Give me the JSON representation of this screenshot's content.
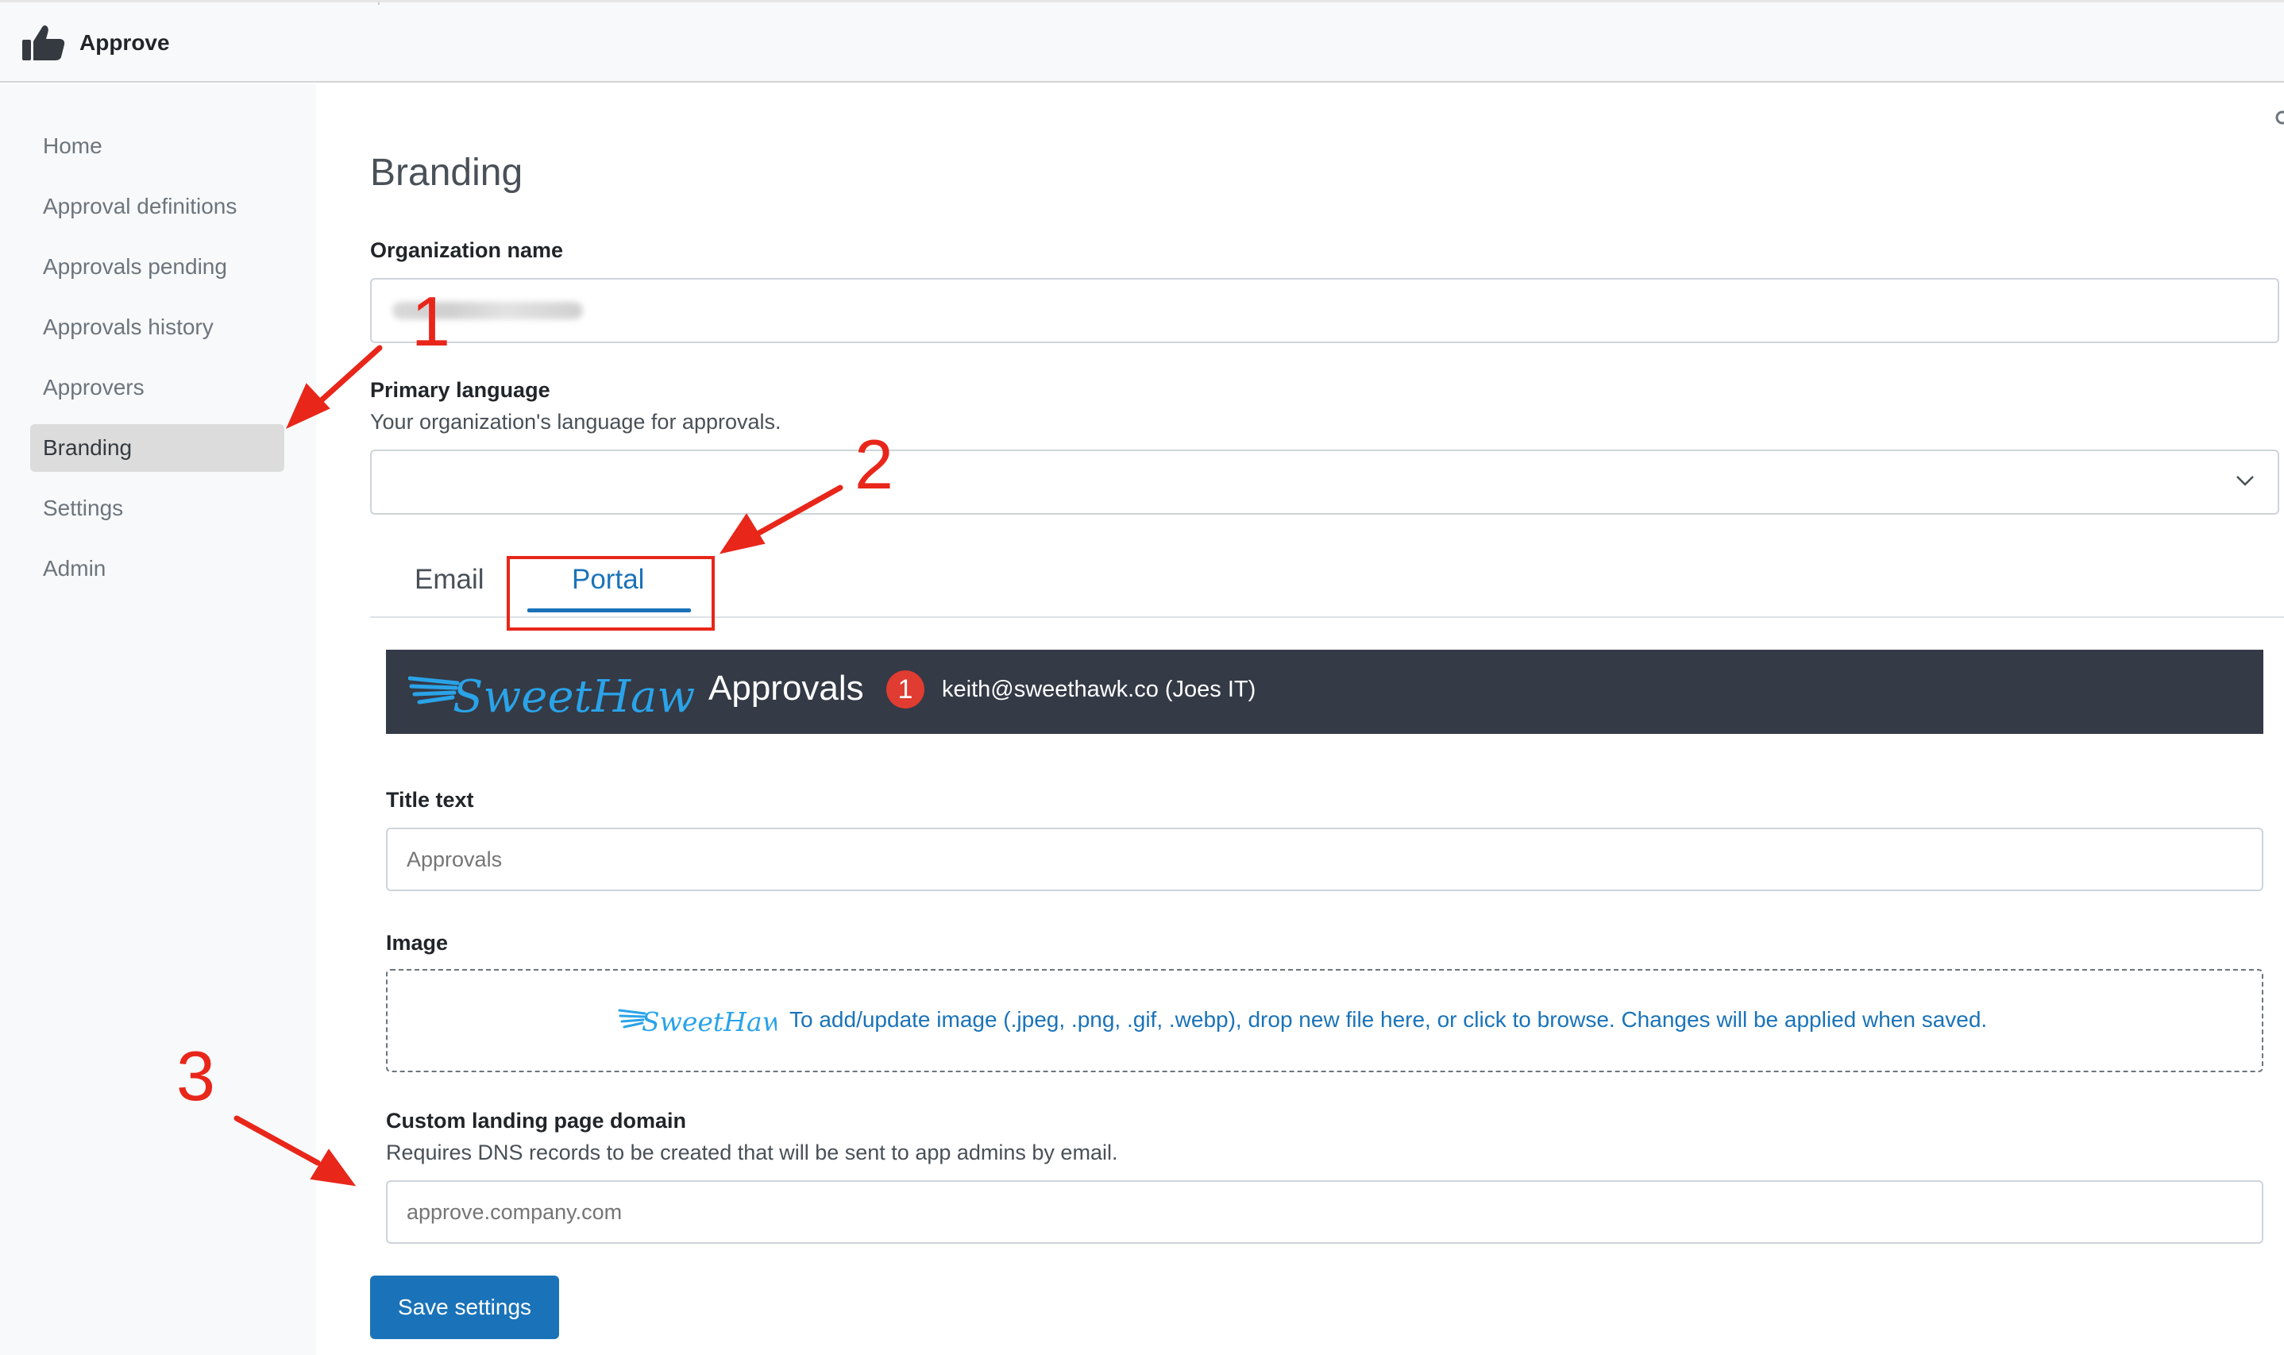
{
  "app": {
    "title": "Approve"
  },
  "sidebar": {
    "items": [
      {
        "label": "Home"
      },
      {
        "label": "Approval definitions"
      },
      {
        "label": "Approvals pending"
      },
      {
        "label": "Approvals history"
      },
      {
        "label": "Approvers"
      },
      {
        "label": "Branding",
        "active": true
      },
      {
        "label": "Settings"
      },
      {
        "label": "Admin"
      }
    ]
  },
  "page": {
    "title": "Branding"
  },
  "form": {
    "org_name": {
      "label": "Organization name"
    },
    "primary_language": {
      "label": "Primary language",
      "help": "Your organization's language for approvals.",
      "value": ""
    },
    "tabs": [
      {
        "label": "Email",
        "active": false
      },
      {
        "label": "Portal",
        "active": true
      }
    ],
    "preview": {
      "brand": "SweetHawk",
      "title": "Approvals",
      "badge_count": "1",
      "user": "keith@sweethawk.co (Joes IT)"
    },
    "title_text": {
      "label": "Title text",
      "placeholder": "Approvals"
    },
    "image": {
      "label": "Image",
      "logo": "SweetHawk",
      "drop_text": "To add/update image (.jpeg, .png, .gif, .webp), drop new file here, or click to browse. Changes will be applied when saved."
    },
    "custom_domain": {
      "label": "Custom landing page domain",
      "help": "Requires DNS records to be created that will be sent to app admins by email.",
      "placeholder": "approve.company.com"
    },
    "save_label": "Save settings"
  },
  "annotations": {
    "one": "1",
    "two": "2",
    "three": "3"
  },
  "colors": {
    "accent": "#1a73b8",
    "annotation": "#e8261a",
    "preview_bg": "#343a46",
    "sidebar_bg": "#f8f9fa",
    "badge": "#e03c31"
  },
  "icons": {
    "app": "thumbs-up-icon",
    "select": "chevron-down-icon"
  }
}
